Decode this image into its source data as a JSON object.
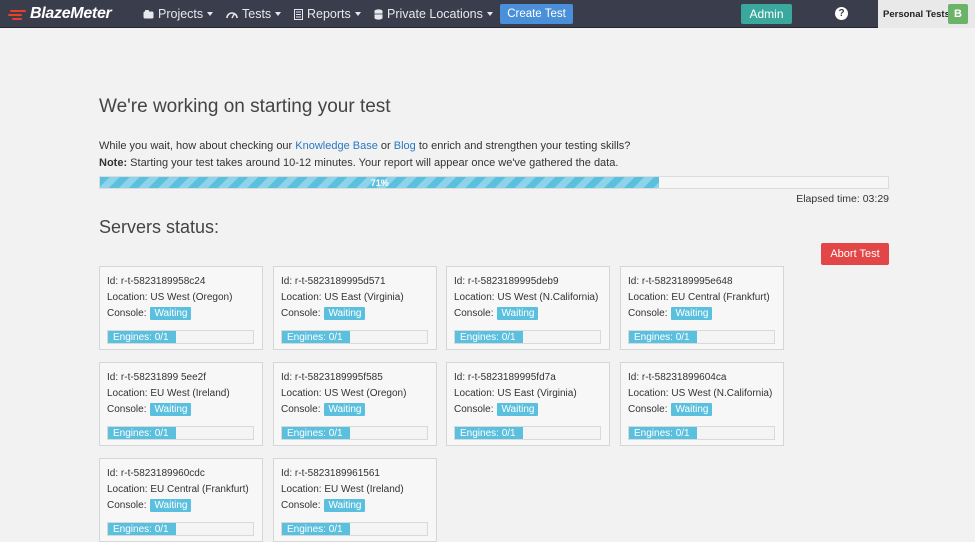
{
  "navbar": {
    "brand": "BlazeMeter",
    "projects": "Projects",
    "tests": "Tests",
    "reports": "Reports",
    "private_locations": "Private Locations",
    "create_test": "Create Test",
    "admin": "Admin",
    "help": "?",
    "workspace": "Personal Tests",
    "avatar_letter": "B"
  },
  "main": {
    "title": "We're working on starting your test",
    "info_prefix": "While you wait, how about checking our",
    "knowledge_base": "Knowledge Base",
    "or": "or",
    "blog": "Blog",
    "info_suffix": "to enrich and strengthen your testing skills?",
    "note_label": "Note:",
    "note_text": "Starting your test takes around 10-12 minutes. Your report will appear once we've gathered the data.",
    "progress_label": "71%",
    "progress_percent": 71,
    "elapsed": "Elapsed time: 03:29",
    "servers_title": "Servers status:",
    "abort": "Abort Test"
  },
  "labels": {
    "id": "Id:",
    "location": "Location:",
    "console": "Console:",
    "waiting": "Waiting",
    "engines": "Engines: 0/1"
  },
  "servers": [
    {
      "id": "r-t-5823189958c24",
      "location": "US West (Oregon)"
    },
    {
      "id": "r-t-5823189995d571",
      "location": "US East (Virginia)"
    },
    {
      "id": "r-t-5823189995deb9",
      "location": "US West (N.California)"
    },
    {
      "id": "r-t-5823189995e648",
      "location": "EU Central (Frankfurt)"
    },
    {
      "id": "r-t-58231899 5ee2f",
      "location": "EU West (Ireland)"
    },
    {
      "id": "r-t-5823189995f585",
      "location": "US West (Oregon)"
    },
    {
      "id": "r-t-5823189995fd7a",
      "location": "US East (Virginia)"
    },
    {
      "id": "r-t-58231899604ca",
      "location": "US West (N.California)"
    },
    {
      "id": "r-t-5823189960cdc",
      "location": "EU Central (Frankfurt)"
    },
    {
      "id": "r-t-5823189961561",
      "location": "EU West (Ireland)"
    }
  ],
  "colors": {
    "navbar": "#3a3e4c",
    "create_button": "#4a90d9",
    "admin_button": "#3ba89d",
    "abort_button": "#e24646",
    "badge": "#5bc0de",
    "avatar": "#6cb36a"
  },
  "icons": [
    "projects-icon",
    "tests-icon",
    "reports-icon",
    "private-locations-icon",
    "help-icon",
    "logo-icon"
  ]
}
